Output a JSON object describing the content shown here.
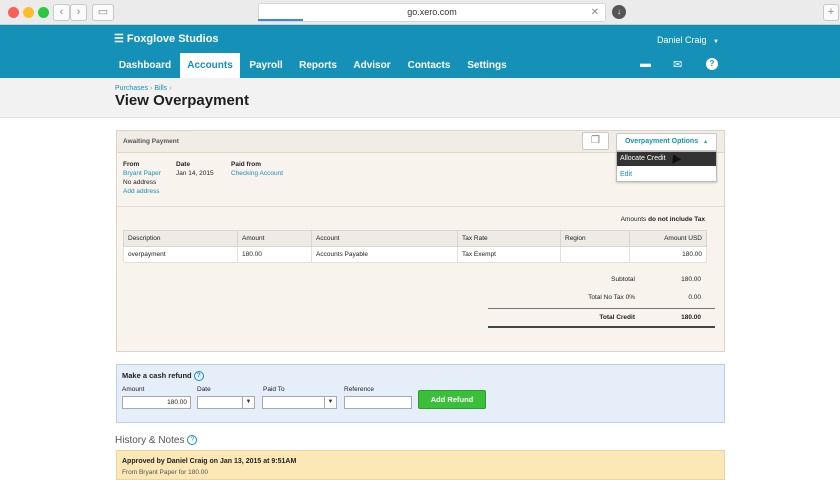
{
  "browser": {
    "url": "go.xero.com",
    "colors": {
      "close": "#fc5f57",
      "minimize": "#fdbc2e",
      "maximize": "#28c840"
    }
  },
  "header": {
    "org_name": "Foxglove Studios",
    "user_name": "Daniel Craig",
    "tabs": [
      "Dashboard",
      "Accounts",
      "Payroll",
      "Reports",
      "Advisor",
      "Contacts",
      "Settings"
    ],
    "active_tab": "Accounts",
    "icons": [
      "folder-icon",
      "mail-icon",
      "help-icon"
    ],
    "brand_color": "#1591b7"
  },
  "breadcrumb": {
    "purchases": "Purchases",
    "bills": "Bills",
    "separator": "›"
  },
  "page_title": "View Overpayment",
  "overpayment": {
    "status": "Awaiting Payment",
    "options_label": "Overpayment Options",
    "menu": {
      "allocate": "Allocate Credit",
      "edit": "Edit"
    },
    "from_label": "From",
    "from_value": "Bryant Paper",
    "no_address": "No address",
    "add_address": "Add address",
    "date_label": "Date",
    "date_value": "Jan 14, 2015",
    "paid_from_label": "Paid from",
    "paid_from_value": "Checking Account",
    "amounts_prefix": "Amounts",
    "amounts_suffix": "do not include Tax",
    "columns": [
      "Description",
      "Amount",
      "Account",
      "Tax Rate",
      "Region",
      "Amount USD"
    ],
    "rows": [
      {
        "description": "overpayment",
        "amount": "180.00",
        "account": "Accounts Payable",
        "tax_rate": "Tax Exempt",
        "region": "",
        "amount_usd": "180.00"
      }
    ],
    "subtotal_label": "Subtotal",
    "subtotal_value": "180.00",
    "tax_label": "Total No Tax 0%",
    "tax_value": "0.00",
    "total_label": "Total Credit",
    "total_value": "180.00"
  },
  "refund": {
    "title": "Make a cash refund",
    "amount_label": "Amount",
    "amount_value": "180.00",
    "date_label": "Date",
    "paid_to_label": "Paid To",
    "reference_label": "Reference",
    "button": "Add Refund"
  },
  "history": {
    "title": "History & Notes",
    "note_title": "Approved by Daniel Craig on Jan 13, 2015 at 9:51AM",
    "note_detail": "From Bryant Paper for 180.00"
  }
}
